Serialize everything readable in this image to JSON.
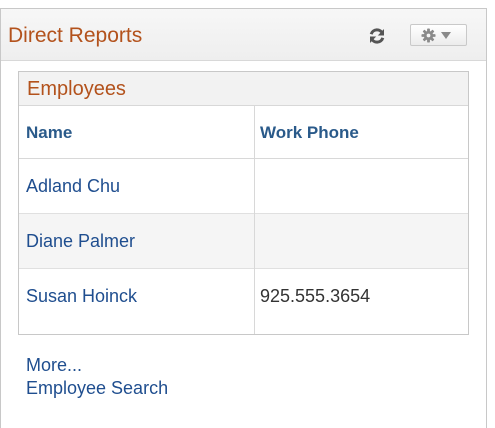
{
  "pagelet": {
    "title": "Direct Reports"
  },
  "grid": {
    "caption": "Employees",
    "columns": [
      "Name",
      "Work Phone"
    ],
    "rows": [
      {
        "name": "Adland Chu",
        "phone": ""
      },
      {
        "name": "Diane Palmer",
        "phone": ""
      },
      {
        "name": "Susan Hoinck",
        "phone": "925.555.3654"
      }
    ]
  },
  "footer": {
    "more_label": "More...",
    "search_label": "Employee Search"
  },
  "icons": {
    "refresh": "refresh-icon",
    "settings": "gear-icon",
    "dropdown": "chevron-down-icon"
  },
  "colors": {
    "title": "#b3521c",
    "link": "#1f4e8f",
    "header_text": "#2a5a8a"
  }
}
